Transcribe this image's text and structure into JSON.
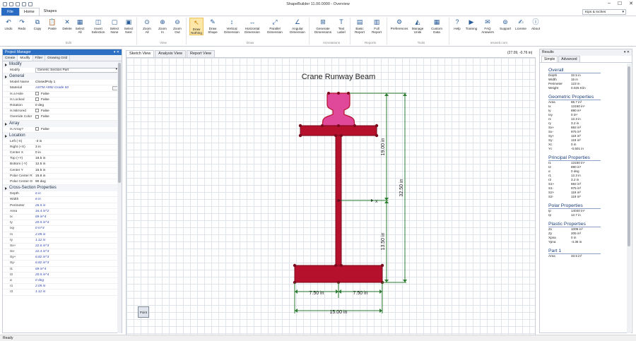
{
  "app": {
    "title": "ShapeBuilder 11.00.0000 - Overview",
    "menu_file": "File",
    "tabs": [
      "Home",
      "Shapes"
    ],
    "units": "Kips & Inches"
  },
  "ribbon": {
    "buttons": [
      {
        "label": "Undo",
        "icon": "undo-icon"
      },
      {
        "label": "Redo",
        "icon": "redo-icon"
      },
      {
        "label": "Copy",
        "icon": "copy-icon"
      },
      {
        "label": "Paste",
        "icon": "paste-icon"
      },
      {
        "label": "Delete",
        "icon": "delete-icon"
      },
      {
        "label": "Select All",
        "icon": "select-all-icon"
      },
      {
        "label": "Invert Selection",
        "icon": "invert-selection-icon"
      },
      {
        "label": "Select None",
        "icon": "select-none-icon"
      },
      {
        "label": "Select Next",
        "icon": "select-next-icon"
      },
      {
        "label": "Zoom All",
        "icon": "zoom-all-icon"
      },
      {
        "label": "Zoom In",
        "icon": "zoom-in-icon"
      },
      {
        "label": "Zoom Out",
        "icon": "zoom-out-icon"
      },
      {
        "label": "Draw Nothing",
        "icon": "pointer-icon"
      },
      {
        "label": "Draw Shape",
        "icon": "draw-shape-icon"
      },
      {
        "label": "Vertical Dimension",
        "icon": "vertical-dimension-icon"
      },
      {
        "label": "Horizontal Dimension",
        "icon": "horizontal-dimension-icon"
      },
      {
        "label": "Parallel Dimension",
        "icon": "parallel-dimension-icon"
      },
      {
        "label": "Angular Dimension",
        "icon": "angular-dimension-icon"
      },
      {
        "label": "Generate Dimensions",
        "icon": "generate-dimensions-icon"
      },
      {
        "label": "Text Label",
        "icon": "text-label-icon"
      },
      {
        "label": "Basic Report",
        "icon": "basic-report-icon"
      },
      {
        "label": "Full Report",
        "icon": "full-report-icon"
      },
      {
        "label": "Preferences",
        "icon": "preferences-icon"
      },
      {
        "label": "Manage Units",
        "icon": "manage-units-icon"
      },
      {
        "label": "Custom Data",
        "icon": "custom-data-icon"
      },
      {
        "label": "Help",
        "icon": "help-icon"
      },
      {
        "label": "Training",
        "icon": "training-icon"
      },
      {
        "label": "FAQ Answers",
        "icon": "faq-icon"
      },
      {
        "label": "Support",
        "icon": "support-icon"
      },
      {
        "label": "License",
        "icon": "license-icon"
      },
      {
        "label": "About",
        "icon": "about-icon"
      }
    ],
    "groups": [
      "Edit",
      "View",
      "Draw",
      "Annotations",
      "Reports",
      "Tools",
      "iesweb.com"
    ]
  },
  "project_manager": {
    "title": "Project Manager",
    "tabs": [
      "Create",
      "Modify",
      "Filter",
      "Drawing Grid"
    ],
    "modify_heading": "Modify",
    "modify_key": "Modify",
    "modify_value": "Generic Section Part",
    "general_heading": "General",
    "general": [
      {
        "k": "Model Name",
        "v": "ClosedPoly 1",
        "type": "text"
      },
      {
        "k": "Material",
        "v": "ASTM A992 Grade 50",
        "type": "italic"
      },
      {
        "k": "Is a Hole",
        "v": "False",
        "type": "check"
      },
      {
        "k": "Is Locked",
        "v": "False",
        "type": "check"
      },
      {
        "k": "Rotation",
        "v": "0 deg",
        "type": "text"
      },
      {
        "k": "Is Mirrored",
        "v": "False",
        "type": "check"
      },
      {
        "k": "Override Color",
        "v": "False",
        "type": "check"
      }
    ],
    "array_heading": "Array",
    "array": [
      {
        "k": "Is Array?",
        "v": "False",
        "type": "check"
      }
    ],
    "location_heading": "Location",
    "location": [
      {
        "k": "Left (-X)",
        "v": "-3 in"
      },
      {
        "k": "Right (+X)",
        "v": "3 in"
      },
      {
        "k": "Center X",
        "v": "0 in"
      },
      {
        "k": "Top (+Y)",
        "v": "18.5 in"
      },
      {
        "k": "Bottom (-Y)",
        "v": "12.5 in"
      },
      {
        "k": "Center Y",
        "v": "15.5 in"
      },
      {
        "k": "Polar Center R",
        "v": "15.8 in"
      },
      {
        "k": "Polar Center Θ",
        "v": "90 deg"
      }
    ],
    "cross_heading": "Cross-Section Properties",
    "cross": [
      {
        "k": "Depth",
        "v": "6 in"
      },
      {
        "k": "Width",
        "v": "6 in"
      },
      {
        "k": "Perimeter",
        "v": "26.5 in"
      },
      {
        "k": "Area",
        "v": "16.4 in^2"
      },
      {
        "k": "Ix",
        "v": "69 in^4"
      },
      {
        "k": "Iy",
        "v": "20.5 in^4"
      },
      {
        "k": "Ixy",
        "v": "0 in^4"
      },
      {
        "k": "rx",
        "v": "2.05 in"
      },
      {
        "k": "ry",
        "v": "1.12 in"
      },
      {
        "k": "Sx+",
        "v": "22.6 in^3"
      },
      {
        "k": "Sx-",
        "v": "22.4 in^3"
      },
      {
        "k": "Sy+",
        "v": "6.82 in^3"
      },
      {
        "k": "Sy-",
        "v": "6.82 in^3"
      },
      {
        "k": "I1",
        "v": "69 in^4"
      },
      {
        "k": "I2",
        "v": "20.5 in^4"
      },
      {
        "k": "α",
        "v": "0 deg"
      },
      {
        "k": "r1",
        "v": "2.05 in"
      },
      {
        "k": "r2",
        "v": "1.12 in"
      }
    ]
  },
  "doc": {
    "tabs": [
      "Sketch View",
      "Analysis View",
      "Report View"
    ],
    "coords": "(27.09, -0.76 in)",
    "drawing_title": "Crane Runway Beam",
    "dims": {
      "upper_vertical": "19.00 in",
      "total_vertical": "32.50 in",
      "lower_vertical": "13.50 in",
      "left_half": "7.50 in",
      "right_half": "7.50 in",
      "total_width": "15.00 in"
    },
    "axis_x": "x",
    "point_button": "Point"
  },
  "results": {
    "title": "Results",
    "tabs": [
      "Simple",
      "Advanced"
    ],
    "overall_heading": "Overall",
    "overall": [
      {
        "k": "Depth",
        "v": "32.5 in"
      },
      {
        "k": "Width",
        "v": "15 in"
      },
      {
        "k": "Perimeter",
        "v": "123 in"
      },
      {
        "k": "Weight",
        "v": "0.025 K/in"
      }
    ],
    "geo_heading": "Geometric Properties",
    "geo": [
      {
        "k": "Area",
        "v": "86.7 in²"
      },
      {
        "k": "Ix",
        "v": "13150 in⁴"
      },
      {
        "k": "Iy",
        "v": "890 in⁴"
      },
      {
        "k": "Ixy",
        "v": "0 in⁴"
      },
      {
        "k": "rx",
        "v": "12.3 in"
      },
      {
        "k": "ry",
        "v": "3.2 in"
      },
      {
        "k": "Sx+",
        "v": "692 in³"
      },
      {
        "k": "Sx-",
        "v": "975 in³"
      },
      {
        "k": "Sy+",
        "v": "119 in³"
      },
      {
        "k": "Sy-",
        "v": "119 in³"
      },
      {
        "k": "Xc",
        "v": "0 in"
      },
      {
        "k": "Yc",
        "v": "-0.501 in"
      }
    ],
    "principal_heading": "Principal Properties",
    "principal": [
      {
        "k": "I1",
        "v": "13150 in⁴"
      },
      {
        "k": "I2",
        "v": "890 in⁴"
      },
      {
        "k": "α",
        "v": "0 deg"
      },
      {
        "k": "r1",
        "v": "12.3 in"
      },
      {
        "k": "r2",
        "v": "3.2 in"
      },
      {
        "k": "S1+",
        "v": "692 in³"
      },
      {
        "k": "S1-",
        "v": "975 in³"
      },
      {
        "k": "S2+",
        "v": "119 in³"
      },
      {
        "k": "S2-",
        "v": "119 in³"
      }
    ],
    "polar_heading": "Polar Properties",
    "polar": [
      {
        "k": "Ip",
        "v": "14040 in⁴"
      },
      {
        "k": "rp",
        "v": "12.7 in"
      }
    ],
    "plastic_heading": "Plastic Properties",
    "plastic": [
      {
        "k": "Zx",
        "v": "1009 in³"
      },
      {
        "k": "Zy",
        "v": "205 in³"
      },
      {
        "k": "Xpna",
        "v": "0 in"
      },
      {
        "k": "Ypna",
        "v": "-4.36 in"
      }
    ],
    "part_heading": "Part 1",
    "part": [
      {
        "k": "Area",
        "v": "33.5 in²"
      }
    ]
  },
  "status": {
    "text": "Ready"
  },
  "colors": {
    "accent": "#2d6fc2",
    "beam": "#b5102c",
    "rail": "#e0489a",
    "dimension": "#2e7d32"
  }
}
